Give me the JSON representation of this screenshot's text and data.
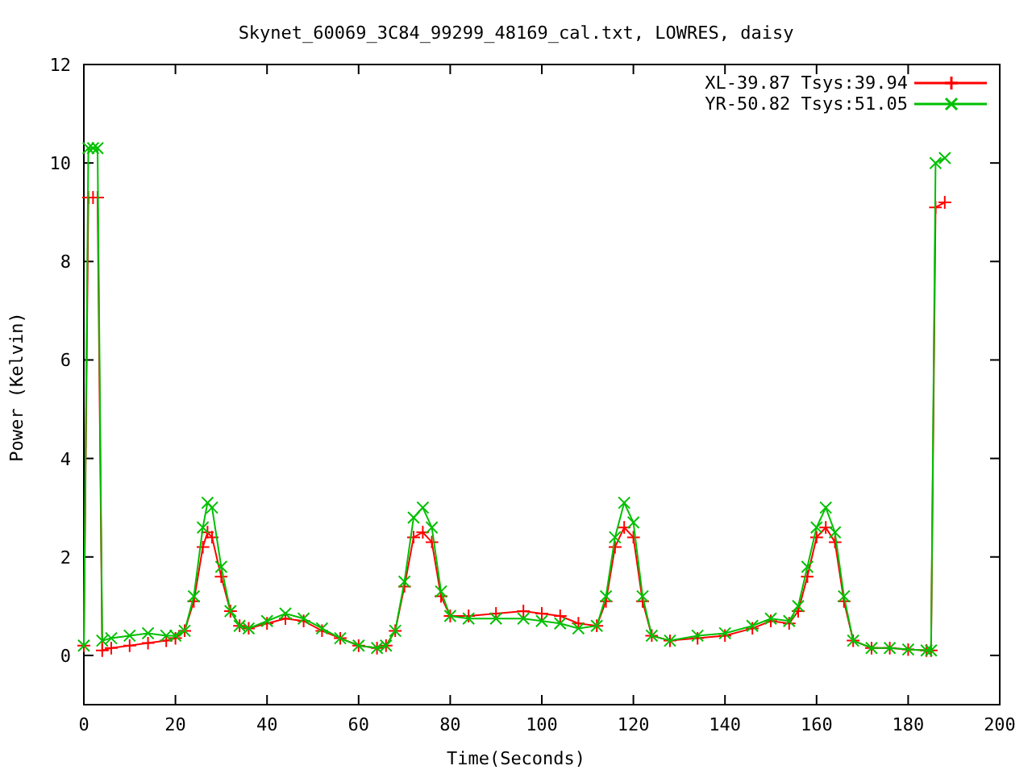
{
  "chart_data": {
    "type": "line",
    "title": "Skynet_60069_3C84_99299_48169_cal.txt, LOWRES, daisy",
    "xlabel": "Time(Seconds)",
    "ylabel": "Power (Kelvin)",
    "x": [
      0,
      1,
      2,
      3,
      4,
      6,
      10,
      14,
      18,
      20,
      22,
      24,
      26,
      27,
      28,
      30,
      32,
      34,
      36,
      40,
      44,
      48,
      52,
      56,
      60,
      64,
      66,
      68,
      70,
      72,
      74,
      76,
      78,
      80,
      84,
      90,
      96,
      100,
      104,
      108,
      112,
      114,
      116,
      118,
      120,
      122,
      124,
      128,
      134,
      140,
      146,
      150,
      154,
      156,
      158,
      160,
      162,
      164,
      166,
      168,
      172,
      176,
      180,
      184,
      185,
      186,
      188
    ],
    "series": [
      {
        "name": "XL-39.87 Tsys:39.94",
        "color": "#ff0000",
        "values": [
          0.2,
          9.3,
          9.3,
          9.3,
          0.1,
          0.15,
          0.2,
          0.25,
          0.3,
          0.35,
          0.5,
          1.1,
          2.2,
          2.5,
          2.4,
          1.6,
          0.9,
          0.6,
          0.55,
          0.65,
          0.75,
          0.7,
          0.5,
          0.35,
          0.2,
          0.15,
          0.2,
          0.5,
          1.4,
          2.4,
          2.5,
          2.3,
          1.2,
          0.8,
          0.8,
          0.85,
          0.9,
          0.85,
          0.8,
          0.65,
          0.6,
          1.1,
          2.2,
          2.6,
          2.4,
          1.1,
          0.4,
          0.3,
          0.35,
          0.4,
          0.55,
          0.7,
          0.65,
          0.9,
          1.6,
          2.4,
          2.6,
          2.3,
          1.1,
          0.3,
          0.15,
          0.15,
          0.12,
          0.1,
          0.1,
          9.1,
          9.2
        ]
      },
      {
        "name": "YR-50.82 Tsys:51.05",
        "color": "#00c000",
        "values": [
          0.2,
          10.3,
          10.3,
          10.3,
          0.3,
          0.35,
          0.4,
          0.45,
          0.4,
          0.4,
          0.5,
          1.2,
          2.6,
          3.1,
          3.0,
          1.8,
          0.9,
          0.6,
          0.55,
          0.7,
          0.85,
          0.75,
          0.55,
          0.35,
          0.2,
          0.15,
          0.2,
          0.5,
          1.5,
          2.8,
          3.0,
          2.6,
          1.3,
          0.8,
          0.75,
          0.75,
          0.75,
          0.7,
          0.65,
          0.55,
          0.6,
          1.2,
          2.4,
          3.1,
          2.7,
          1.2,
          0.4,
          0.3,
          0.4,
          0.45,
          0.6,
          0.75,
          0.7,
          1.0,
          1.8,
          2.6,
          3.0,
          2.5,
          1.2,
          0.3,
          0.15,
          0.15,
          0.12,
          0.1,
          0.1,
          10.0,
          10.1
        ]
      }
    ],
    "xlim": [
      0,
      200
    ],
    "ylim": [
      -1,
      12
    ],
    "xticks": [
      0,
      20,
      40,
      60,
      80,
      100,
      120,
      140,
      160,
      180,
      200
    ],
    "yticks": [
      0,
      2,
      4,
      6,
      8,
      10,
      12
    ],
    "legend": "upper right"
  }
}
